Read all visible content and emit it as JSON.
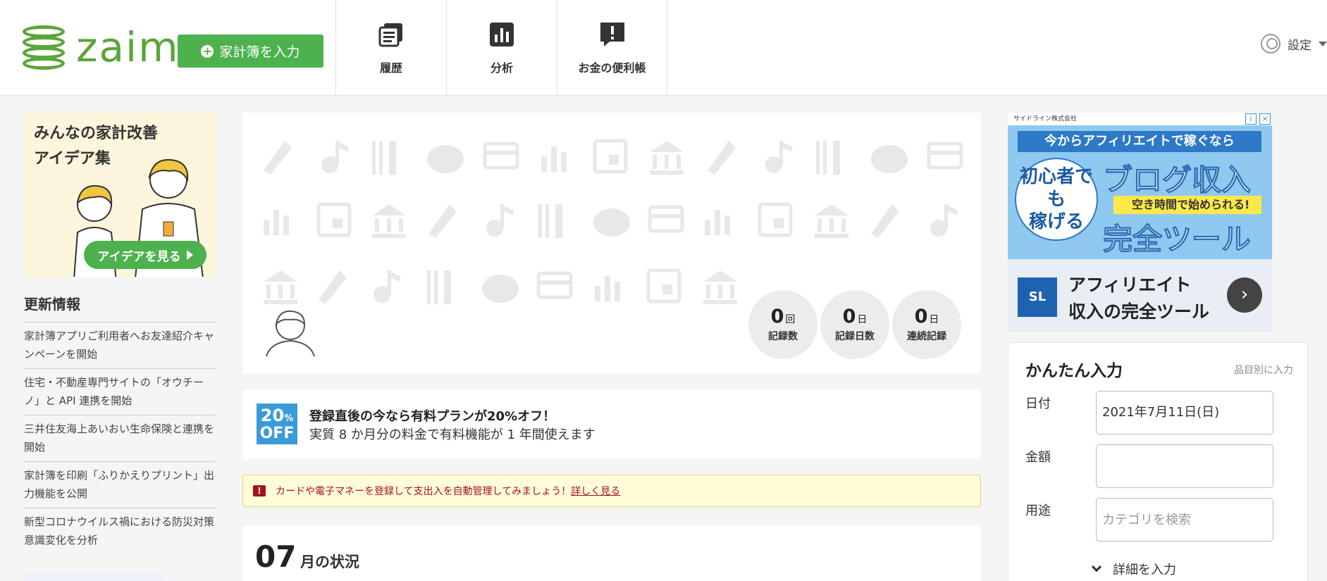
{
  "header": {
    "logo_text": "zaim",
    "input_button": "家計簿を入力",
    "nav": [
      {
        "label": "履歴",
        "icon": "history-icon"
      },
      {
        "label": "分析",
        "icon": "analysis-chart-icon"
      },
      {
        "label": "お金の便利帳",
        "icon": "info-notebook-icon"
      }
    ],
    "settings_label": "設定"
  },
  "left": {
    "banner_title": "みんなの家計改善\nアイデア集",
    "banner_button": "アイデアを見る",
    "news_title": "更新情報",
    "news": [
      "家計簿アプリご利用者へお友達紹介キャンペーンを開始",
      "住宅・不動産専門サイトの「オウチーノ」と API 連携を開始",
      "三井住友海上あいおい生命保険と連携を開始",
      "家計簿を印刷「ふりかえりプリント」出力機能を公開",
      "新型コロナウイルス禍における防災対策意識変化を分析"
    ]
  },
  "profile": {
    "stats": [
      {
        "num": "0",
        "unit": "回",
        "label": "記録数"
      },
      {
        "num": "0",
        "unit": "日",
        "label": "記録日数"
      },
      {
        "num": "0",
        "unit": "日",
        "label": "連続記録"
      }
    ]
  },
  "promo": {
    "badge_top": "20",
    "badge_pct": "%",
    "badge_bottom": "OFF",
    "title": "登録直後の今なら有料プランが20%オフ！",
    "sub": "実質 8 か月分の料金で有料機能が 1 年間使えます"
  },
  "alert": {
    "text": "カードや電子マネーを登録して支出入を自動管理してみましょう！",
    "link": "詳しく見る"
  },
  "month": {
    "num": "07",
    "label": "月の状況"
  },
  "ad": {
    "company": "サイドライン株式会社",
    "band": "今からアフィリエイトで稼ぐなら",
    "circle": "初心者でも\n稼げる",
    "big1": "ブログ収入",
    "yellow": "空き時間で始められる!",
    "big2": "完全ツール",
    "logo": "SL",
    "copy": "アフィリエイト\n収入の完全ツール",
    "arrow": "›"
  },
  "quick": {
    "title": "かんたん入力",
    "link": "品目別に入力",
    "date_label": "日付",
    "date_value": "2021年7月11日(日)",
    "amount_label": "金額",
    "amount_value": "",
    "category_label": "用途",
    "category_placeholder": "カテゴリを検索",
    "detail": "詳細を入力"
  },
  "colors": {
    "brand_green": "#5aa63a",
    "button_green": "#4db24d",
    "alert_red": "#a4121c",
    "alert_bg": "#fffcd8",
    "promo_blue": "#3a9bd8"
  }
}
